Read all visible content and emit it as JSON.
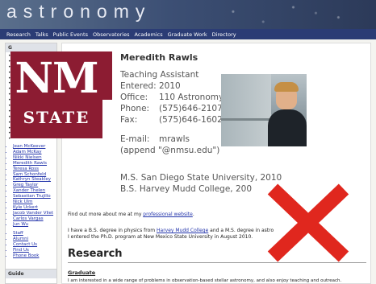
{
  "header": {
    "site_title": "astronomy",
    "nav": [
      "Research",
      "Talks",
      "Public Events",
      "Observatories",
      "Academics",
      "Graduate Work",
      "Directory"
    ]
  },
  "sidebar": {
    "top_title": "G",
    "people": [
      "Jean McKeever",
      "Adam McKay",
      "Nikki Nielsen",
      "Meredith Rawls",
      "Teresa Ross",
      "Sam Schonfeld",
      "Kathryn Steakley",
      "Greg Taylor",
      "Xander Thelen",
      "Sebastian Trujillo",
      "Nick Ulm",
      "Kyle Uckert",
      "Jacob Vander Vliet",
      "Carlos Vargas",
      "Jun Wu"
    ],
    "misc": [
      "Staff",
      "Alumni",
      "Contact Us",
      "Find Us",
      "Phone Book"
    ],
    "guide_title": "Guide"
  },
  "logo": {
    "line1": "NM",
    "line2": "STATE",
    "color": "#8c1c32"
  },
  "profile": {
    "name": "Meredith Rawls",
    "role": "Teaching Assistant",
    "entered": "Entered: 2010",
    "office_label": "Office:",
    "office_value": "110 Astronomy",
    "phone_label": "Phone:",
    "phone_value": "(575)646-2107",
    "fax_label": "Fax:",
    "fax_value": "(575)646-1602",
    "email_label": "E-mail:",
    "email_value": "mrawls",
    "email_note": "(append \"@nmsu.edu\")",
    "degree1": "M.S. San Diego State University, 2010",
    "degree2": "B.S. Harvey Mudd College,        200"
  },
  "find_more": {
    "prefix": "Find out more about me at my ",
    "link": "professional website",
    "suffix": "."
  },
  "bio": {
    "part1": "I have a B.S. degree in physics from ",
    "link": "Harvey Mudd College",
    "part2": " and a M.S. degree in astro",
    "line2": "I entered the Ph.D. program at New Mexico State University in August 2010."
  },
  "research": {
    "heading": "Research",
    "subheading": "Graduate",
    "text": "I am interested in a wide range of problems in observation-based stellar astronomy, and also enjoy teaching and outreach."
  },
  "colors": {
    "nav_bg": "#2b3c75",
    "link": "#2233aa",
    "x_red": "#e0271e"
  }
}
